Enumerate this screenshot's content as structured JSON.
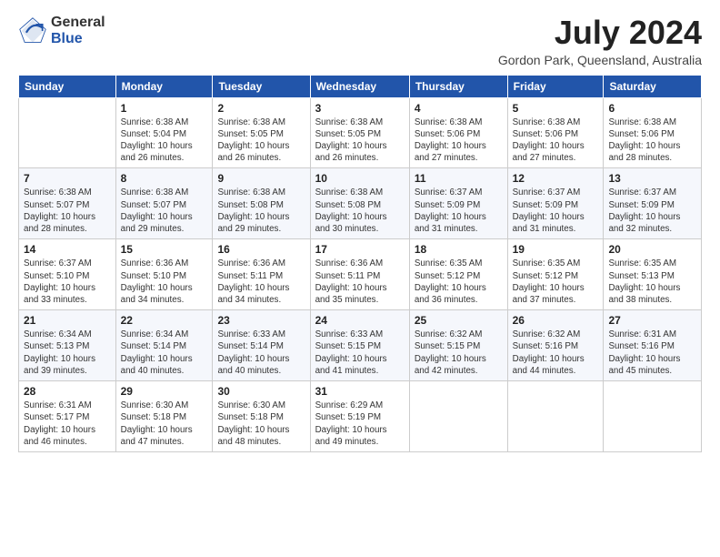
{
  "header": {
    "logo_general": "General",
    "logo_blue": "Blue",
    "month": "July 2024",
    "location": "Gordon Park, Queensland, Australia"
  },
  "days_of_week": [
    "Sunday",
    "Monday",
    "Tuesday",
    "Wednesday",
    "Thursday",
    "Friday",
    "Saturday"
  ],
  "weeks": [
    [
      {
        "day": "",
        "info": ""
      },
      {
        "day": "1",
        "info": "Sunrise: 6:38 AM\nSunset: 5:04 PM\nDaylight: 10 hours\nand 26 minutes."
      },
      {
        "day": "2",
        "info": "Sunrise: 6:38 AM\nSunset: 5:05 PM\nDaylight: 10 hours\nand 26 minutes."
      },
      {
        "day": "3",
        "info": "Sunrise: 6:38 AM\nSunset: 5:05 PM\nDaylight: 10 hours\nand 26 minutes."
      },
      {
        "day": "4",
        "info": "Sunrise: 6:38 AM\nSunset: 5:06 PM\nDaylight: 10 hours\nand 27 minutes."
      },
      {
        "day": "5",
        "info": "Sunrise: 6:38 AM\nSunset: 5:06 PM\nDaylight: 10 hours\nand 27 minutes."
      },
      {
        "day": "6",
        "info": "Sunrise: 6:38 AM\nSunset: 5:06 PM\nDaylight: 10 hours\nand 28 minutes."
      }
    ],
    [
      {
        "day": "7",
        "info": "Sunrise: 6:38 AM\nSunset: 5:07 PM\nDaylight: 10 hours\nand 28 minutes."
      },
      {
        "day": "8",
        "info": "Sunrise: 6:38 AM\nSunset: 5:07 PM\nDaylight: 10 hours\nand 29 minutes."
      },
      {
        "day": "9",
        "info": "Sunrise: 6:38 AM\nSunset: 5:08 PM\nDaylight: 10 hours\nand 29 minutes."
      },
      {
        "day": "10",
        "info": "Sunrise: 6:38 AM\nSunset: 5:08 PM\nDaylight: 10 hours\nand 30 minutes."
      },
      {
        "day": "11",
        "info": "Sunrise: 6:37 AM\nSunset: 5:09 PM\nDaylight: 10 hours\nand 31 minutes."
      },
      {
        "day": "12",
        "info": "Sunrise: 6:37 AM\nSunset: 5:09 PM\nDaylight: 10 hours\nand 31 minutes."
      },
      {
        "day": "13",
        "info": "Sunrise: 6:37 AM\nSunset: 5:09 PM\nDaylight: 10 hours\nand 32 minutes."
      }
    ],
    [
      {
        "day": "14",
        "info": "Sunrise: 6:37 AM\nSunset: 5:10 PM\nDaylight: 10 hours\nand 33 minutes."
      },
      {
        "day": "15",
        "info": "Sunrise: 6:36 AM\nSunset: 5:10 PM\nDaylight: 10 hours\nand 34 minutes."
      },
      {
        "day": "16",
        "info": "Sunrise: 6:36 AM\nSunset: 5:11 PM\nDaylight: 10 hours\nand 34 minutes."
      },
      {
        "day": "17",
        "info": "Sunrise: 6:36 AM\nSunset: 5:11 PM\nDaylight: 10 hours\nand 35 minutes."
      },
      {
        "day": "18",
        "info": "Sunrise: 6:35 AM\nSunset: 5:12 PM\nDaylight: 10 hours\nand 36 minutes."
      },
      {
        "day": "19",
        "info": "Sunrise: 6:35 AM\nSunset: 5:12 PM\nDaylight: 10 hours\nand 37 minutes."
      },
      {
        "day": "20",
        "info": "Sunrise: 6:35 AM\nSunset: 5:13 PM\nDaylight: 10 hours\nand 38 minutes."
      }
    ],
    [
      {
        "day": "21",
        "info": "Sunrise: 6:34 AM\nSunset: 5:13 PM\nDaylight: 10 hours\nand 39 minutes."
      },
      {
        "day": "22",
        "info": "Sunrise: 6:34 AM\nSunset: 5:14 PM\nDaylight: 10 hours\nand 40 minutes."
      },
      {
        "day": "23",
        "info": "Sunrise: 6:33 AM\nSunset: 5:14 PM\nDaylight: 10 hours\nand 40 minutes."
      },
      {
        "day": "24",
        "info": "Sunrise: 6:33 AM\nSunset: 5:15 PM\nDaylight: 10 hours\nand 41 minutes."
      },
      {
        "day": "25",
        "info": "Sunrise: 6:32 AM\nSunset: 5:15 PM\nDaylight: 10 hours\nand 42 minutes."
      },
      {
        "day": "26",
        "info": "Sunrise: 6:32 AM\nSunset: 5:16 PM\nDaylight: 10 hours\nand 44 minutes."
      },
      {
        "day": "27",
        "info": "Sunrise: 6:31 AM\nSunset: 5:16 PM\nDaylight: 10 hours\nand 45 minutes."
      }
    ],
    [
      {
        "day": "28",
        "info": "Sunrise: 6:31 AM\nSunset: 5:17 PM\nDaylight: 10 hours\nand 46 minutes."
      },
      {
        "day": "29",
        "info": "Sunrise: 6:30 AM\nSunset: 5:18 PM\nDaylight: 10 hours\nand 47 minutes."
      },
      {
        "day": "30",
        "info": "Sunrise: 6:30 AM\nSunset: 5:18 PM\nDaylight: 10 hours\nand 48 minutes."
      },
      {
        "day": "31",
        "info": "Sunrise: 6:29 AM\nSunset: 5:19 PM\nDaylight: 10 hours\nand 49 minutes."
      },
      {
        "day": "",
        "info": ""
      },
      {
        "day": "",
        "info": ""
      },
      {
        "day": "",
        "info": ""
      }
    ]
  ]
}
